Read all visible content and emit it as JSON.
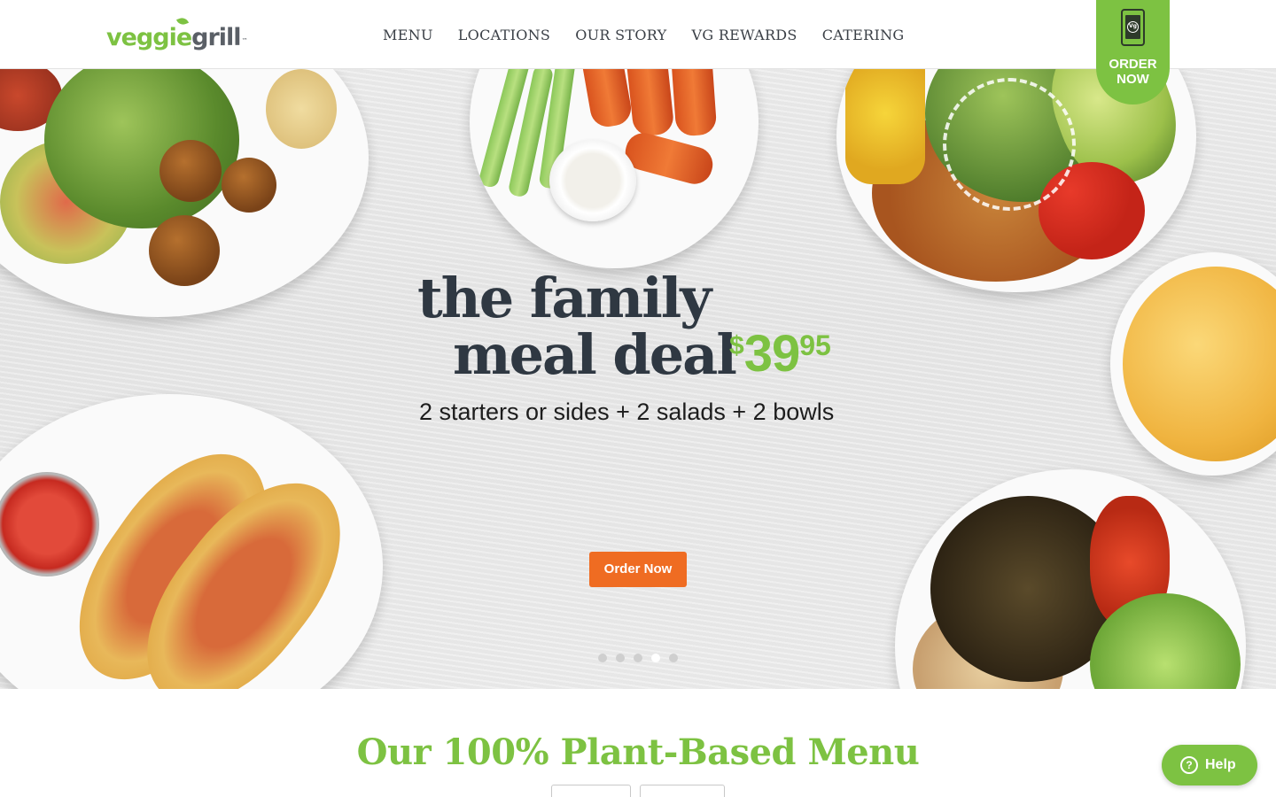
{
  "header": {
    "logo": {
      "part1": "veggie",
      "part2": "grill",
      "tm": "™"
    },
    "nav": [
      {
        "label": "MENU"
      },
      {
        "label": "LOCATIONS"
      },
      {
        "label": "OUR STORY"
      },
      {
        "label": "VG REWARDS"
      },
      {
        "label": "CATERING"
      }
    ],
    "order_tab": {
      "label_line1": "ORDER",
      "label_line2": "NOW",
      "icon": "phone-icon",
      "icon_badge": "Vg"
    }
  },
  "hero": {
    "headline_line1": "the family",
    "headline_line2": "meal deal",
    "price": {
      "currency": "$",
      "dollars": "39",
      "cents": "95"
    },
    "subheadline": "2 starters or sides + 2 salads + 2 bowls",
    "cta_label": "Order Now",
    "carousel": {
      "total_slides": 5,
      "active_index": 3
    }
  },
  "menu_section": {
    "title": "Our 100% Plant-Based Menu"
  },
  "help_widget": {
    "label": "Help",
    "icon": "question-icon"
  },
  "colors": {
    "brand_green": "#7dc242",
    "cta_orange": "#ef6c22",
    "headline_dark": "#2f3842"
  }
}
